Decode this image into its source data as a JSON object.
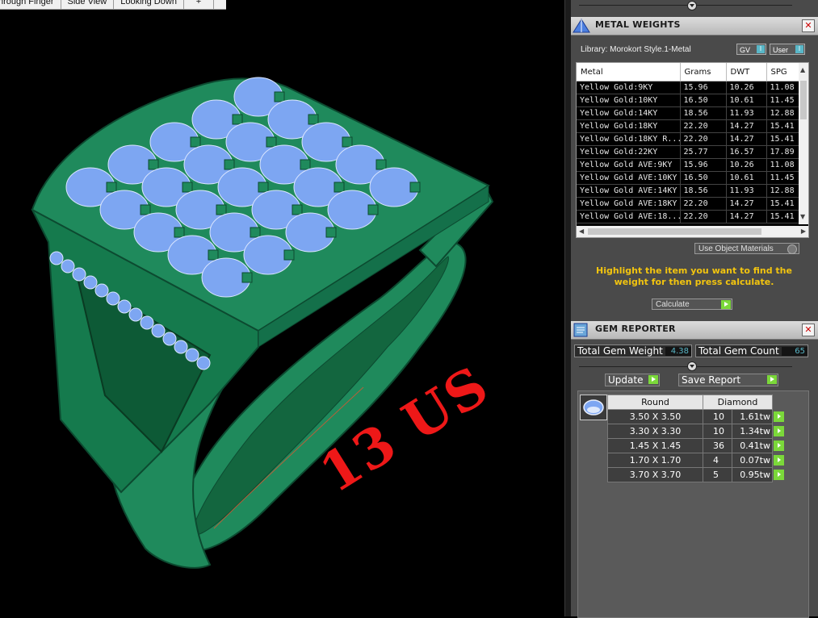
{
  "viewport": {
    "tabs": [
      "hrough Finger",
      "Side View",
      "Looking Down"
    ],
    "add_tab": "+",
    "size_label": "13 US"
  },
  "metal_weights": {
    "title": "METAL WEIGHTS",
    "library_label": "Library: Morokort Style.1-Metal",
    "gv_label": "GV",
    "user_label": "User",
    "toggle_indicator": "I",
    "columns": [
      "Metal",
      "Grams",
      "DWT",
      "SPG"
    ],
    "rows": [
      [
        "Yellow Gold:9KY",
        "15.96",
        "10.26",
        "11.08"
      ],
      [
        "Yellow Gold:10KY",
        "16.50",
        "10.61",
        "11.45"
      ],
      [
        "Yellow Gold:14KY",
        "18.56",
        "11.93",
        "12.88"
      ],
      [
        "Yellow Gold:18KY",
        "22.20",
        "14.27",
        "15.41"
      ],
      [
        "Yellow Gold:18KY R...",
        "22.20",
        "14.27",
        "15.41"
      ],
      [
        "Yellow Gold:22KY",
        "25.77",
        "16.57",
        "17.89"
      ],
      [
        "Yellow Gold AVE:9KY",
        "15.96",
        "10.26",
        "11.08"
      ],
      [
        "Yellow Gold AVE:10KY",
        "16.50",
        "10.61",
        "11.45"
      ],
      [
        "Yellow Gold AVE:14KY",
        "18.56",
        "11.93",
        "12.88"
      ],
      [
        "Yellow Gold AVE:18KY",
        "22.20",
        "14.27",
        "15.41"
      ],
      [
        "Yellow Gold AVE:18...",
        "22.20",
        "14.27",
        "15.41"
      ]
    ],
    "use_object_materials": "Use Object Materials",
    "hint": "Highlight the item you want to find the weight for then press calculate.",
    "calculate_label": "Calculate"
  },
  "gem_reporter": {
    "title": "GEM REPORTER",
    "total_weight_label": "Total Gem Weight",
    "total_weight_value": "4.38",
    "total_count_label": "Total Gem Count",
    "total_count_value": "65",
    "update_label": "Update",
    "save_report_label": "Save Report",
    "shape_header": "Round",
    "stone_header": "Diamond",
    "rows": [
      {
        "size": "3.50 X 3.50",
        "count": "10",
        "tw": "1.61tw"
      },
      {
        "size": "3.30 X 3.30",
        "count": "10",
        "tw": "1.34tw"
      },
      {
        "size": "1.45 X 1.45",
        "count": "36",
        "tw": "0.41tw"
      },
      {
        "size": "1.70 X 1.70",
        "count": "4",
        "tw": "0.07tw"
      },
      {
        "size": "3.70 X 3.70",
        "count": "5",
        "tw": "0.95tw"
      }
    ]
  },
  "colors": {
    "ring_green": "#1f8a5c",
    "gem_blue": "#7da6f2",
    "label_red": "#ee1818",
    "hint_yellow": "#f2c40f",
    "go_green": "#7bd83a",
    "value_cyan": "#59b7c8"
  }
}
